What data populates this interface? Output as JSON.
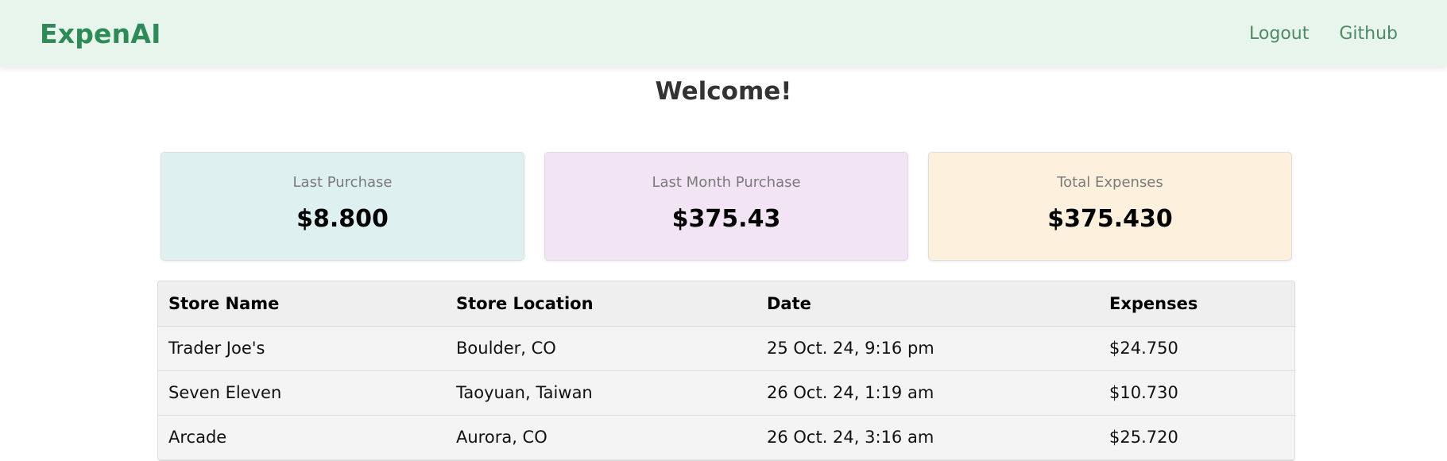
{
  "nav": {
    "brand": "ExpenAI",
    "links": [
      "Logout",
      "Github"
    ]
  },
  "welcome": "Welcome!",
  "cards": [
    {
      "title": "Last Purchase",
      "value": "$8.800",
      "bg": "#dff0f0"
    },
    {
      "title": "Last Month Purchase",
      "value": "$375.43",
      "bg": "#f2e4f4"
    },
    {
      "title": "Total Expenses",
      "value": "$375.430",
      "bg": "#fdf1de"
    }
  ],
  "table": {
    "headers": [
      "Store Name",
      "Store Location",
      "Date",
      "Expenses"
    ],
    "rows": [
      [
        "Trader Joe's",
        "Boulder, CO",
        "25 Oct. 24, 9:16 pm",
        "$24.750"
      ],
      [
        "Seven Eleven",
        "Taoyuan, Taiwan",
        "26 Oct. 24, 1:19 am",
        "$10.730"
      ],
      [
        "Arcade",
        "Aurora, CO",
        "26 Oct. 24, 3:16 am",
        "$25.720"
      ]
    ]
  },
  "colors": {
    "brand": "#2e8b57",
    "navbar_bg": "#e8f5ec",
    "nav_link": "#4f8a64"
  }
}
